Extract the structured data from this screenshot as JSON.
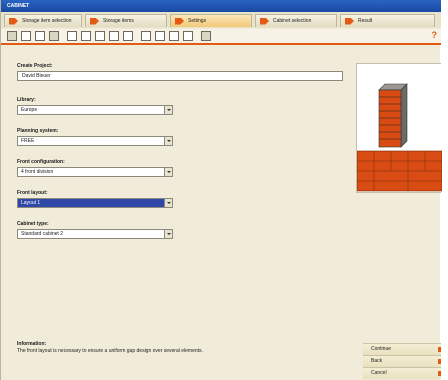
{
  "window": {
    "title": "CABINET"
  },
  "steps": [
    {
      "label": "Storage item selection",
      "active": false
    },
    {
      "label": "Storage items",
      "active": false
    },
    {
      "label": "Settings",
      "active": true
    },
    {
      "label": "Cabinet selection",
      "active": false
    },
    {
      "label": "Result",
      "active": false
    }
  ],
  "toolbar": {
    "help_glyph": "?"
  },
  "form": {
    "project": {
      "label": "Create Project:",
      "value": "David Bleuer"
    },
    "library": {
      "label": "Library:",
      "value": "Europe"
    },
    "planning": {
      "label": "Planning system:",
      "value": "FREE"
    },
    "front_config": {
      "label": "Front configuration:",
      "value": "4 front division"
    },
    "front_layout": {
      "label": "Front layout:",
      "value": "Layout 1"
    },
    "cabinet_type": {
      "label": "Cabinet type:",
      "value": "Standard cabinet 2"
    }
  },
  "info": {
    "label": "Information:",
    "text": "The front layout is necessary to ensure a uniform gap design over several elements."
  },
  "nav": {
    "continue": "Continue",
    "back": "Back",
    "cancel": "Cancel"
  },
  "colors": {
    "accent": "#e25a14",
    "selection": "#2f48a8",
    "panel": "#f0ecd9"
  }
}
